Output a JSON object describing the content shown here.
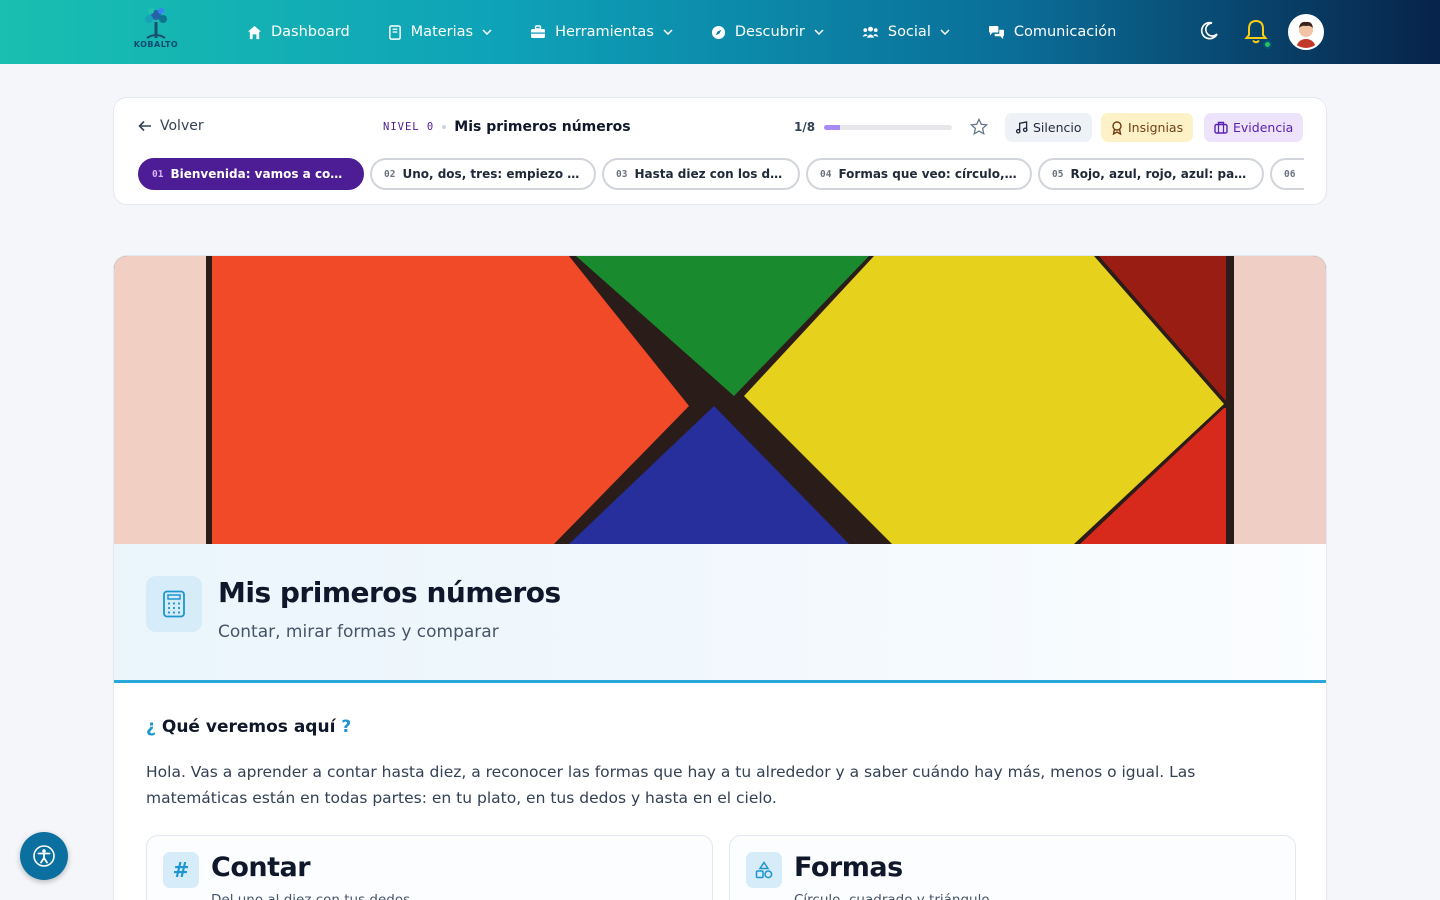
{
  "nav": {
    "logo_text": "KOBALTO",
    "items": [
      {
        "label": "Dashboard",
        "icon": "home-icon",
        "has_menu": false
      },
      {
        "label": "Materias",
        "icon": "book-icon",
        "has_menu": true
      },
      {
        "label": "Herramientas",
        "icon": "toolbox-icon",
        "has_menu": true
      },
      {
        "label": "Descubrir",
        "icon": "compass-icon",
        "has_menu": true
      },
      {
        "label": "Social",
        "icon": "users-icon",
        "has_menu": true
      },
      {
        "label": "Comunicación",
        "icon": "chat-icon",
        "has_menu": false
      }
    ]
  },
  "lesson_bar": {
    "back_label": "Volver",
    "level": "NIVEL 0",
    "title": "Mis primeros números",
    "progress_text": "1/8",
    "progress_fraction": 0.125,
    "silencio": "Silencio",
    "insignias": "Insignias",
    "evidencia": "Evidencia",
    "chapters": [
      {
        "num": "01",
        "title": "Bienvenida: vamos a contar...",
        "active": true
      },
      {
        "num": "02",
        "title": "Uno, dos, tres: empiezo a c...",
        "active": false
      },
      {
        "num": "03",
        "title": "Hasta diez con los dedos",
        "active": false
      },
      {
        "num": "04",
        "title": "Formas que veo: círculo, cu...",
        "active": false
      },
      {
        "num": "05",
        "title": "Rojo, azul, rojo, azul: patron...",
        "active": false
      },
      {
        "num": "06",
        "title": "",
        "active": false
      }
    ]
  },
  "hero": {
    "title": "Mis primeros números",
    "subtitle": "Contar, mirar formas y comparar",
    "section_title": "Qué veremos aquí",
    "section_open": "¿",
    "section_close": "?",
    "intro": "Hola. Vas a aprender a contar hasta diez, a reconocer las formas que hay a tu alrededor y a saber cuándo hay más, menos o igual. Las matemáticas están en todas partes: en tu plato, en tus dedos y hasta en el cielo.",
    "topics": [
      {
        "icon_text": "#",
        "title": "Contar",
        "subtitle": "Del uno al diez con tus dedos"
      },
      {
        "icon_text": "",
        "title": "Formas",
        "subtitle": "Círculo, cuadrado y triángulo"
      }
    ]
  },
  "colors": {
    "accent": "#4c1d95",
    "blue": "#1d95cf"
  }
}
